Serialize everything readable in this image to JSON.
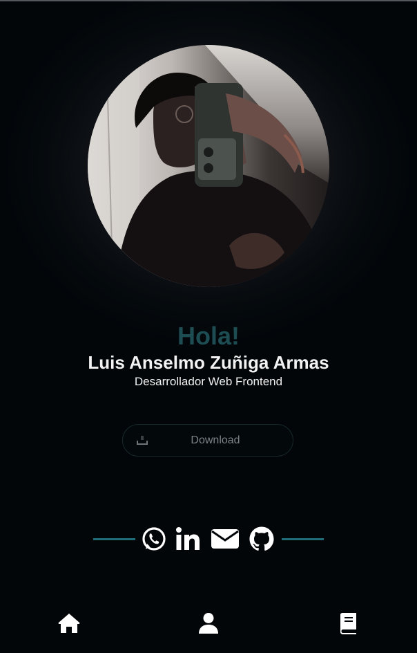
{
  "profile": {
    "greeting": "Hola!",
    "name": "Luis Anselmo Zuñiga Armas",
    "role": "Desarrollador Web Frontend"
  },
  "actions": {
    "download_label": "Download",
    "download_icon": "download-icon"
  },
  "social": {
    "icons": [
      "whatsapp-icon",
      "linkedin-icon",
      "email-icon",
      "github-icon"
    ]
  },
  "bottom_nav": {
    "icons": [
      "home-icon",
      "user-icon",
      "book-icon"
    ]
  },
  "colors": {
    "greeting": "#1d4d53",
    "accent_line": "#1e6d78",
    "text": "#f2f2f2",
    "background": "#020609"
  }
}
